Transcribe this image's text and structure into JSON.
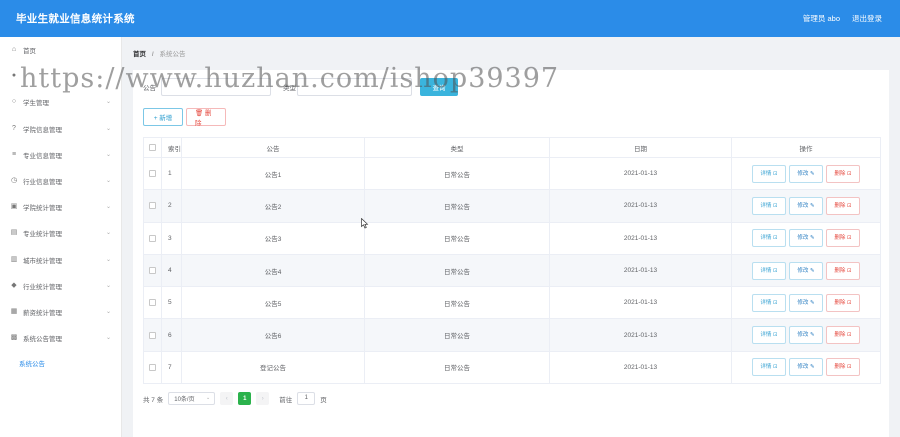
{
  "header": {
    "title": "毕业生就业信息统计系统",
    "user": "管理员 abo",
    "logout": "退出登录"
  },
  "sidebar": {
    "items": [
      {
        "label": "首页",
        "icon": "home-icon",
        "glyph": "⌂",
        "expandable": false
      },
      {
        "label": "",
        "icon": "user-icon",
        "glyph": "●",
        "expandable": false
      },
      {
        "label": "学生管理",
        "icon": "circle-icon",
        "glyph": "○",
        "expandable": true
      },
      {
        "label": "学院信息管理",
        "icon": "question-circle-icon",
        "glyph": "?",
        "expandable": true
      },
      {
        "label": "专业信息管理",
        "icon": "sliders-icon",
        "glyph": "≡",
        "expandable": true
      },
      {
        "label": "行业信息管理",
        "icon": "clock-icon",
        "glyph": "◷",
        "expandable": true
      },
      {
        "label": "学院统计管理",
        "icon": "bank-icon",
        "glyph": "▣",
        "expandable": true
      },
      {
        "label": "专业统计管理",
        "icon": "printer-icon",
        "glyph": "▤",
        "expandable": true
      },
      {
        "label": "城市统计管理",
        "icon": "bar-chart-icon",
        "glyph": "▥",
        "expandable": true
      },
      {
        "label": "行业统计管理",
        "icon": "location-icon",
        "glyph": "◆",
        "expandable": true
      },
      {
        "label": "薪资统计管理",
        "icon": "message-icon",
        "glyph": "▦",
        "expandable": true
      },
      {
        "label": "系统公告管理",
        "icon": "briefcase-icon",
        "glyph": "▩",
        "expandable": true
      }
    ],
    "sub_item": "系统公告"
  },
  "breadcrumb": {
    "home": "首页",
    "separator": "/",
    "current": "系统公告"
  },
  "search": {
    "title_label": "公告",
    "title_placeholder": "",
    "type_label": "类型",
    "button": "查询"
  },
  "toolbar": {
    "add": "+ 新增",
    "delete": "🗑 删除"
  },
  "table": {
    "columns": [
      "",
      "索引",
      "公告",
      "类型",
      "日期",
      "操作"
    ],
    "rows": [
      {
        "index": "1",
        "title": "公告1",
        "type": "日常公告",
        "date": "2021-01-13"
      },
      {
        "index": "2",
        "title": "公告2",
        "type": "日常公告",
        "date": "2021-01-13"
      },
      {
        "index": "3",
        "title": "公告3",
        "type": "日常公告",
        "date": "2021-01-13"
      },
      {
        "index": "4",
        "title": "公告4",
        "type": "日常公告",
        "date": "2021-01-13"
      },
      {
        "index": "5",
        "title": "公告5",
        "type": "日常公告",
        "date": "2021-01-13"
      },
      {
        "index": "6",
        "title": "公告6",
        "type": "日常公告",
        "date": "2021-01-13"
      },
      {
        "index": "7",
        "title": "登记公告",
        "type": "日常公告",
        "date": "2021-01-13"
      }
    ],
    "actions": {
      "detail": "详情 ⊡",
      "edit": "修改 ✎",
      "delete": "删除 ⊡"
    }
  },
  "pagination": {
    "total": "共 7 条",
    "page_size": "10条/页",
    "prev": "‹",
    "current": "1",
    "next": "›",
    "goto_label": "前往",
    "goto_value": "1",
    "page_suffix": "页"
  },
  "watermark": "https://www.huzhan.com/ishop39397",
  "colors": {
    "header": "#2b8ce8",
    "accent": "#3ab4dd",
    "danger": "#e5483e",
    "page_active": "#2bb24c"
  }
}
